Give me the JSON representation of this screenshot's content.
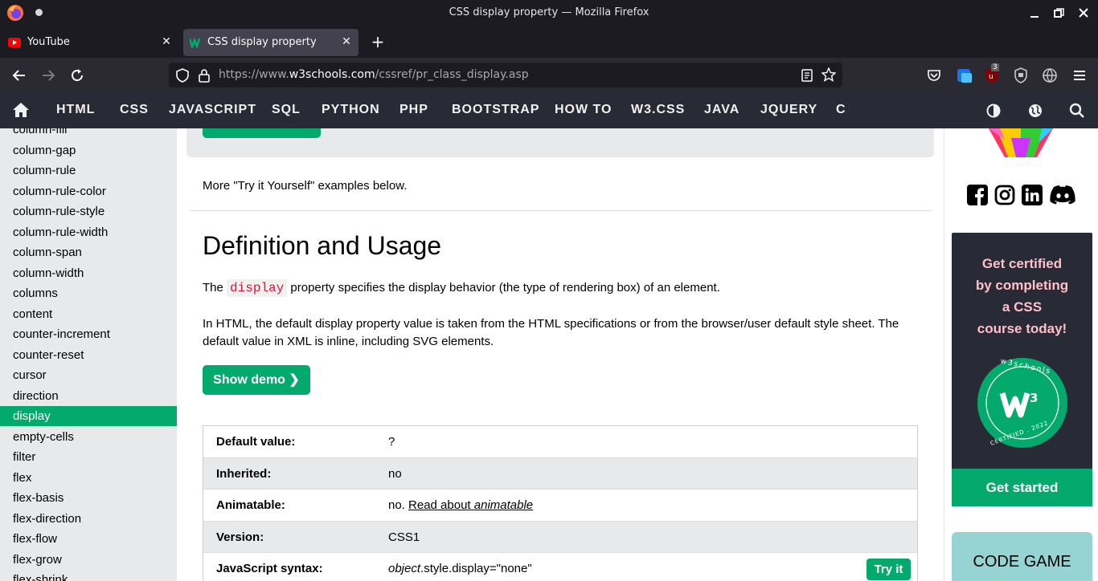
{
  "window": {
    "title": "CSS display property — Mozilla Firefox"
  },
  "tabs": [
    {
      "label": "YouTube",
      "icon": "youtube-icon"
    },
    {
      "label": "CSS display property",
      "icon": "w3schools-icon"
    }
  ],
  "urlbar": {
    "prefix": "https://www.",
    "domain": "w3schools.com",
    "path": "/cssref/pr_class_display.asp"
  },
  "extensions": {
    "ublock_badge": "3"
  },
  "topnav": [
    "HTML",
    "CSS",
    "JAVASCRIPT",
    "SQL",
    "PYTHON",
    "PHP",
    "BOOTSTRAP",
    "HOW TO",
    "W3.CSS",
    "JAVA",
    "JQUERY",
    "C"
  ],
  "sidebar": {
    "items": [
      "column-fill",
      "column-gap",
      "column-rule",
      "column-rule-color",
      "column-rule-style",
      "column-rule-width",
      "column-span",
      "column-width",
      "columns",
      "content",
      "counter-increment",
      "counter-reset",
      "cursor",
      "direction",
      "display",
      "empty-cells",
      "filter",
      "flex",
      "flex-basis",
      "flex-direction",
      "flex-flow",
      "flex-grow",
      "flex-shrink"
    ],
    "active": "display"
  },
  "main": {
    "more_text": "More \"Try it Yourself\" examples below.",
    "heading": "Definition and Usage",
    "p1_before": "The ",
    "p1_code": "display",
    "p1_after": " property specifies the display behavior (the type of rendering box) of an element.",
    "p2": "In HTML, the default display property value is taken from the HTML specifications or from the browser/user default style sheet. The default value in XML is inline, including SVG elements.",
    "show_demo": "Show demo ❯",
    "table": {
      "default_key": "Default value:",
      "default_val": "?",
      "inherited_key": "Inherited:",
      "inherited_val": "no",
      "animatable_key": "Animatable:",
      "animatable_val": "no. ",
      "animatable_link": "Read about ",
      "animatable_link_em": "animatable",
      "version_key": "Version:",
      "version_val": "CSS1",
      "js_key": "JavaScript syntax:",
      "js_obj": "object",
      "js_rest": ".style.display=\"none\"",
      "try_it": "Try it"
    }
  },
  "right": {
    "cert_lines": [
      "Get certified",
      "by completing",
      "a CSS",
      "course today!"
    ],
    "badge_top": "w3schools",
    "badge_bottom": "CERTIFIED . 2022",
    "get_started": "Get started",
    "code_game": "CODE GAME"
  },
  "colors": {
    "accent": "#04aa6d",
    "nav_bg": "#282a35",
    "sidebar_bg": "#e7e9eb",
    "code_red": "#dc143c"
  }
}
